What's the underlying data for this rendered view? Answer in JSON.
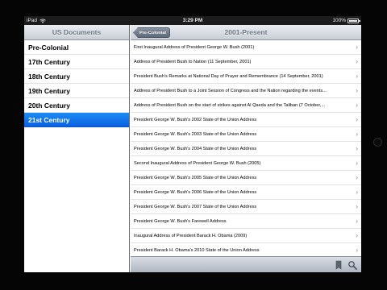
{
  "status_bar": {
    "carrier": "iPad",
    "time": "3:29 PM",
    "battery": "100%",
    "battery_level": 1.0
  },
  "master": {
    "title": "US Documents",
    "items": [
      {
        "label": "Pre-Colonial",
        "selected": false
      },
      {
        "label": "17th Century",
        "selected": false
      },
      {
        "label": "18th Century",
        "selected": false
      },
      {
        "label": "19th Century",
        "selected": false
      },
      {
        "label": "20th Century",
        "selected": false
      },
      {
        "label": "21st Century",
        "selected": true
      }
    ]
  },
  "detail": {
    "title": "2001-Present",
    "back_label": "Pre-Colonial",
    "documents": [
      "First Inaugural Address of President George W. Bush (2001)",
      "Address of President Bush to Nation (11 September, 2001)",
      "President Bush's Remarks at National Day of Prayer and Remembrance (14 September, 2001)",
      "Address of President Bush to a Joint Session of Congress and the Nation regarding the events...",
      "Address of President Bush on the start of strikes against Al Qaeda and the Taliban (7 October,...",
      "President George W. Bush's 2002 State of the Union Address",
      "President George W. Bush's 2003 State of the Union Address",
      "President George W. Bush's 2004 State of the Union Address",
      "Second Inaugural Address of President George W. Bush (2005)",
      "President George W. Bush's 2005 State of the Union Address",
      "President George W. Bush's 2006 State of the Union Address",
      "President George W. Bush's 2007 State of the Union Address",
      "President George W. Bush's Farewell Address",
      "Inaugural Address of President Barack H. Obama (2009)",
      "President Barack H. Obama's 2010 State of the Union Address"
    ],
    "toolbar_icons": [
      "bookmark-icon",
      "search-icon"
    ]
  },
  "colors": {
    "selection": "#1473ea",
    "nav_bar_text": "#6f7885",
    "status_bar": "#1c1c1c"
  }
}
